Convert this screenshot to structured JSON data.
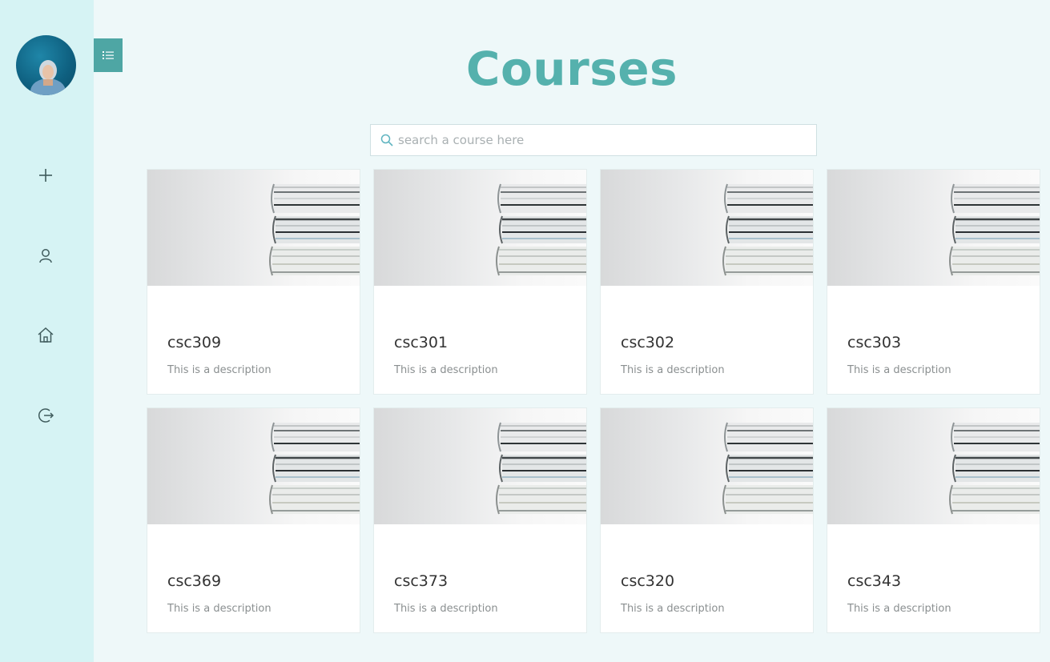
{
  "page": {
    "title": "Courses"
  },
  "search": {
    "placeholder": "search a course here",
    "value": ""
  },
  "sidebar": {
    "items": [
      {
        "icon": "plus-icon"
      },
      {
        "icon": "user-icon"
      },
      {
        "icon": "home-icon"
      },
      {
        "icon": "logout-icon"
      }
    ]
  },
  "courses": [
    {
      "code": "csc309",
      "description": "This is a description"
    },
    {
      "code": "csc301",
      "description": "This is a description"
    },
    {
      "code": "csc302",
      "description": "This is a description"
    },
    {
      "code": "csc303",
      "description": "This is a description"
    },
    {
      "code": "csc369",
      "description": "This is a description"
    },
    {
      "code": "csc373",
      "description": "This is a description"
    },
    {
      "code": "csc320",
      "description": "This is a description"
    },
    {
      "code": "csc343",
      "description": "This is a description"
    }
  ],
  "colors": {
    "accent": "#55b1ad",
    "sidebar_bg": "#d6f3f4",
    "page_bg": "#eef8f9",
    "toggle_bg": "#4ea6a4"
  }
}
